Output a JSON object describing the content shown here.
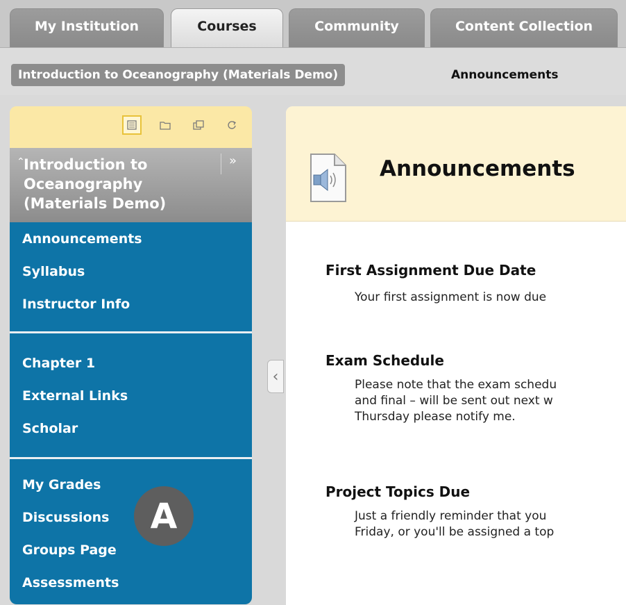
{
  "top_tabs": [
    {
      "label": "My Institution"
    },
    {
      "label": "Courses"
    },
    {
      "label": "Community"
    },
    {
      "label": "Content Collection"
    }
  ],
  "breadcrumb": {
    "course": "Introduction to Oceanography (Materials Demo)",
    "current": "Announcements"
  },
  "sidebar": {
    "tools": [
      "list-view-icon",
      "folder-view-icon",
      "new-window-icon",
      "refresh-icon"
    ],
    "course_title": "Introduction to Oceanography (Materials Demo)",
    "group1": [
      "Announcements",
      "Syllabus",
      "Instructor Info"
    ],
    "group2": [
      "Chapter 1",
      "External Links",
      "Scholar"
    ],
    "group3": [
      "My Grades",
      "Discussions",
      "Groups Page",
      "Assessments"
    ],
    "badge": "A"
  },
  "main": {
    "title": "Announcements",
    "announcements": [
      {
        "title": "First Assignment Due Date",
        "body": "Your first assignment is now due"
      },
      {
        "title": "Exam Schedule",
        "body": "Please note that the exam schedu\nand final – will be sent out next w\nThursday please notify me."
      },
      {
        "title": "Project Topics Due",
        "body": "Just a friendly reminder that you\nFriday, or you'll be assigned a top"
      }
    ]
  },
  "colors": {
    "menu_blue": "#0e74a7",
    "highlight_yellow": "#fdf3d3"
  }
}
